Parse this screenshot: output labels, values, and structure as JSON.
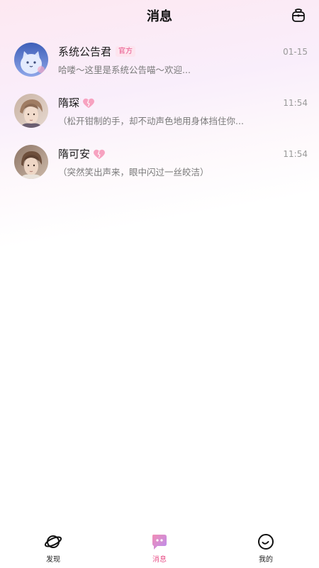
{
  "header": {
    "title": "消息",
    "right_icon": "lucky-bag-icon"
  },
  "conversations": [
    {
      "name": "系统公告君",
      "badge": "官方",
      "time": "01-15",
      "preview": "哈喽～这里是系统公告喵～欢迎...",
      "avatar": "cat-avatar"
    },
    {
      "name": "隋琛",
      "time": "11:54",
      "preview": "（松开钳制的手，却不动声色地用身体挡住你...",
      "avatar": "character-avatar",
      "emoji": "pink-heart-icon"
    },
    {
      "name": "隋可安",
      "time": "11:54",
      "preview": "（突然笑出声来，眼中闪过一丝皎洁）",
      "avatar": "character-avatar",
      "emoji": "pink-heart-icon"
    }
  ],
  "tabbar": {
    "tabs": [
      {
        "label": "发现",
        "icon": "planet-icon",
        "active": false
      },
      {
        "label": "消息",
        "icon": "chat-bubble-icon",
        "active": true
      },
      {
        "label": "我的",
        "icon": "smile-face-icon",
        "active": false
      }
    ]
  },
  "colors": {
    "accent": "#e8548a",
    "text": "#1a1a1a",
    "muted": "#999999"
  }
}
